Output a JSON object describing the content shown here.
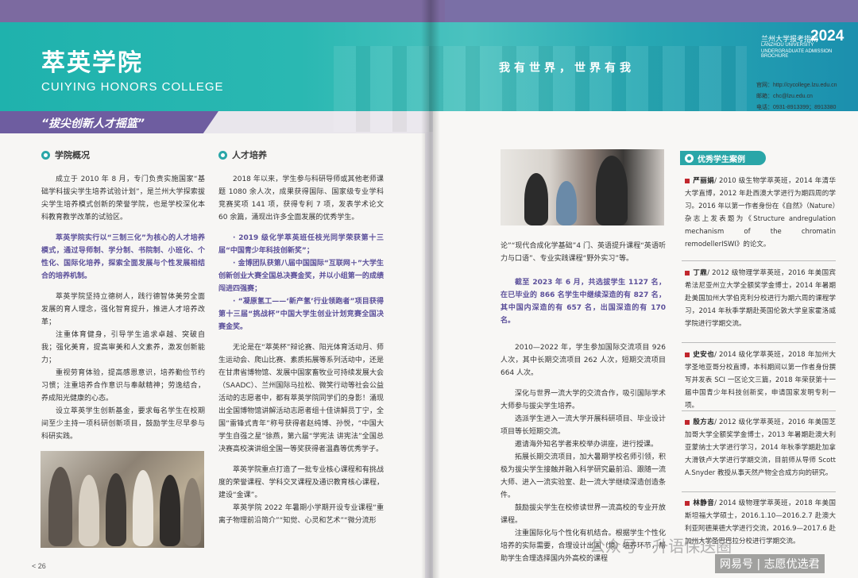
{
  "header": {
    "title_cn": "萃英学院",
    "title_en": "CUIYING HONORS COLLEGE",
    "slogan": "我有世界，世界有我",
    "ribbon": "“拔尖创新人才摇篮”",
    "guide_cn": "兰州大学报考指南",
    "guide_year": "2024",
    "guide_en_1": "LANZHOU UNIVERSITY",
    "guide_en_2": "UNDERGRADUATE ADMISSION BROCHURE"
  },
  "contacts": [
    "官网：http://cycollege.lzu.edu.cn",
    "邮箱：chc@lzu.edu.cn",
    "电话：0931-8913399；8913380"
  ],
  "sections": {
    "overview_title": "学院概况",
    "talent_title": "人才培养",
    "cases_title": "优秀学生案例"
  },
  "col1": {
    "p1": "成立于 2010 年 8 月，专门负责实施国家“基础学科拔尖学生培养试验计划”，是兰州大学探索拔尖学生培养模式创新的荣誉学院，也是学校深化本科教育教学改革的试验区。",
    "p2": "萃英学院实行以“三制三化”为核心的人才培养模式，通过导师制、学分制、书院制、小班化、个性化、国际化培养，探索全面发展与个性发展相结合的培养机制。",
    "p3": "萃英学院坚持立德树人，践行德智体美劳全面发展的育人理念，强化智育提升，推进人才培养改革；",
    "p4": "注重体育健身，引导学生追求卓越、突破自我；强化美育，提高审美和人文素养，激发创新能力；",
    "p5": "重视劳育体验，提高感恩意识，培养勤俭节约习惯；注重培养合作意识与奉献精神；劳逸结合，养成阳光健康的心态。",
    "p6": "设立萃英学生创新基金，要求每名学生在校期间至少主持一项科研创新项目，鼓励学生尽早参与科研实践。"
  },
  "col2": {
    "p1": "2018 年以来，学生参与科研导师或其他老师课题 1080 余人次，成果获得国际、国家级专业学科竞赛奖项 141 项，获得专利 7 项，发表学术论文 60 余篇，涌现出许多全面发展的优秀学生。",
    "h1": "· 2019 级化学萃英班任枝光同学荣获第十三届“中国青少年科技创新奖”；",
    "h2": "· 金博团队获第八届中国国际“互联网＋”大学生创新创业大赛全国总决赛金奖，并以小组第一的成绩闯进四强赛；",
    "h3": "· “凝原氢工——‘新产氢’行业领跑者”项目获得第十三届“挑战杯”中国大学生创业计划竞赛全国决赛金奖。",
    "p2": "无论是在“萃英杯”辩论赛、阳光体育活动月、师生运动会、爬山比赛、素质拓展等系列活动中，还是在甘肃省博物馆、发展中国家畜牧业可持续发展大会（SAADC）、兰州国际马拉松、微笑行动等社会公益活动的志愿者中，都有萃英学院同学们的身影！涌现出全国博物馆讲解活动志愿者组十佳讲解员丁宁，全国“雷锋式青年”称号获得者赵纯博、孙悦，“中国大学生自强之星”徐燕，第六届“学宪法 讲宪法”全国总决赛高校演讲组全国一等奖获得者温鑫等优秀学子。",
    "p3": "萃英学院重点打造了一批专业核心课程和有挑战度的荣誉课程、学科交叉课程及通识教育核心课程，建设“金课”。",
    "p4": "萃英学院 2022 年暑期小学期开设专业课程“重离子物理前沿简介”“知觉、心灵和艺术”“微分流形"
  },
  "col3": {
    "p0": "论”“现代合成化学基础”4 门、英语提升课程“英语听力与口语”、专业实践课程“野外实习”等。",
    "h1": "截至 2023 年 6 月，共选拔学生 1127 名，在已毕业的 866 名学生中继续深造的有 827 名，其中国内深造的有 657 名，出国深造的有 170 名。",
    "p1": "2010—2022 年，学生参加国际交流项目 926 人次，其中长期交流项目 262 人次，短期交流项目 664 人次。",
    "p2": "深化与世界一流大学的交流合作，吸引国际学术大师参与拔尖学生培养。",
    "p3": "选派学生进入一流大学开展科研项目、毕业设计项目等长短期交流。",
    "p4": "邀请海外知名学者来校举办讲座，进行授课。",
    "p5": "拓展长期交流项目，加大暑期学校名师引领，积极为拔尖学生接触并融入科学研究最前沿、跟随一流大师、进入一流实验室、赴一流大学继续深造创造条件。",
    "p6": "鼓励拔尖学生在校修读世界一流高校的专业开放课程。",
    "p7": "注重国际化与个性化有机结合。根据学生个性化培养的实际需要，合理设计出国（境）培养环节，帮助学生合理选择国内外高校的课程"
  },
  "cases": [
    {
      "name": "严丽娟",
      "text": "/ 2010 级生物学萃英班，2014 年清华大学直博，2012 年赴西澳大学进行为期四周的学习。2016 年以第一作者身份在《自然》（Nature）杂志上发表题为《Structure andregulation mechanism of the chromatin remodellerISWI》的论文。"
    },
    {
      "name": "丁鼎",
      "text": "/ 2012 级物理学萃英班，2016 年美国宾希法尼亚州立大学全额奖学金博士，2014 年暑期赴美国加州大学伯克利分校进行为期六周的课程学习，2014 年秋季学期赴英国伦敦大学皇家霍洛威学院进行学期交流。"
    },
    {
      "name": "史安也",
      "text": "/ 2014 级化学萃英班，2018 年加州大学圣地亚哥分校直博，本科期间以第一作者身份撰写并发表 SCI 一区论文三篇，2018 年荣获第十一届中国青少年科技创新奖，申请国家发明专利一项。"
    },
    {
      "name": "殷方志",
      "text": "/ 2012 级化学萃英班，2016 年美国芝加哥大学全额奖学金博士，2013 年暑期赴澳大利亚蒙纳士大学进行学习，2014 年秋季学期赴加拿大滑铁卢大学进行学期交流，目前师从导师 Scott A.Snyder 教授从事天然产物全合成方向的研究。"
    },
    {
      "name": "林静音",
      "text": "/ 2014 级物理学萃英班，2018 年美国斯坦福大学硕士，2016.1.10—2016.2.7 赴澳大利亚阿德莱德大学进行交流，2016.9—2017.6 赴加州大学圣巴巴拉分校进行学期交流。"
    }
  ],
  "page_number": "< 26",
  "watermark": {
    "line1": "公众号 · 升语保送圈",
    "line2": "网易号 | 志愿优选君"
  }
}
